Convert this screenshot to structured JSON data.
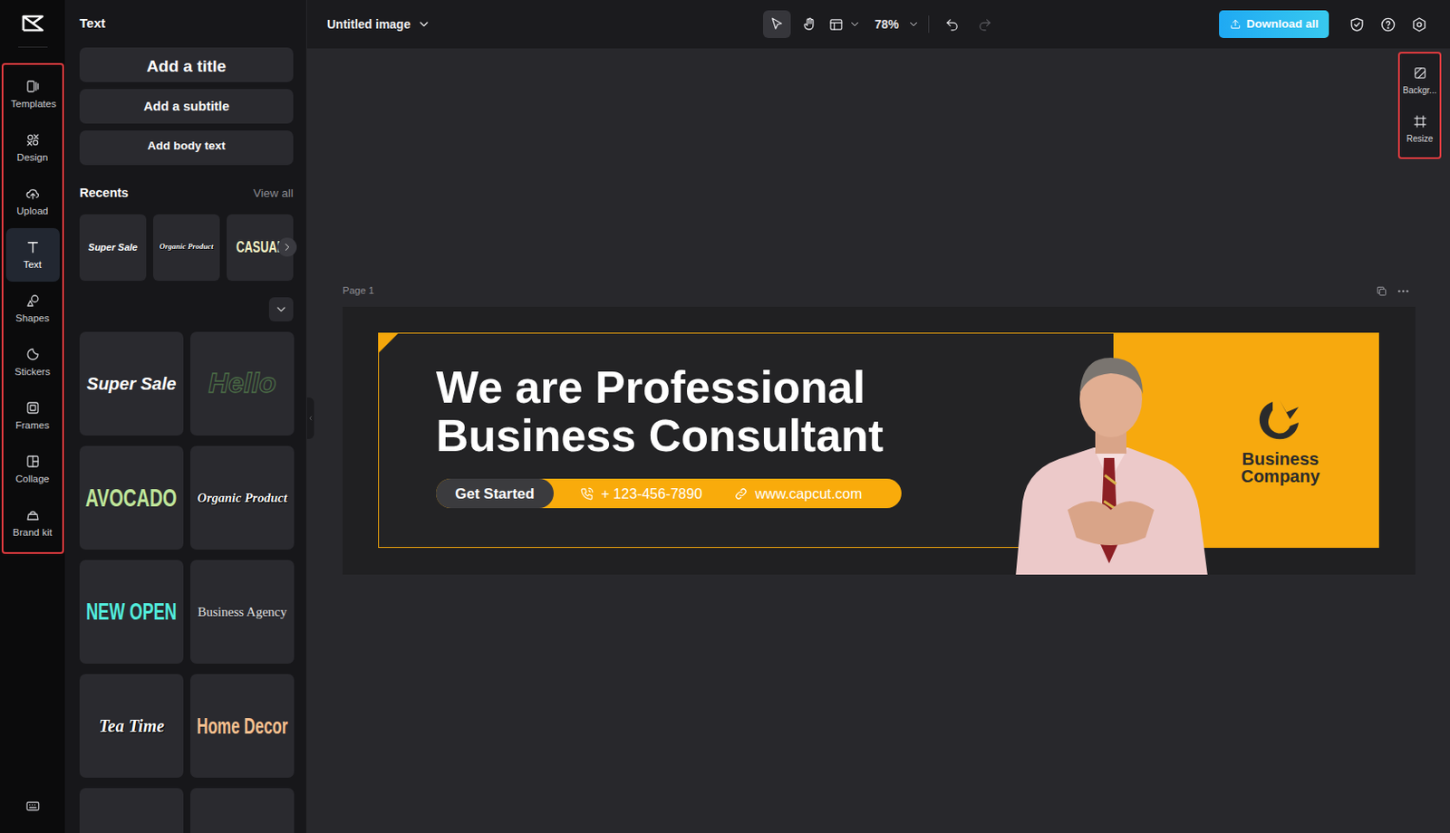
{
  "app": {
    "title": "Untitled image",
    "zoom": "78%",
    "download": "Download all",
    "select_tool_selected": true,
    "hand_tool_selected": false,
    "redo_disabled": true
  },
  "rail": {
    "items": [
      {
        "label": "Templates",
        "selected": false
      },
      {
        "label": "Design",
        "selected": false
      },
      {
        "label": "Upload",
        "selected": false
      },
      {
        "label": "Text",
        "selected": true
      },
      {
        "label": "Shapes",
        "selected": false
      },
      {
        "label": "Stickers",
        "selected": false
      },
      {
        "label": "Frames",
        "selected": false
      },
      {
        "label": "Collage",
        "selected": false
      },
      {
        "label": "Brand kit",
        "selected": false
      }
    ]
  },
  "panel": {
    "title": "Text",
    "buttons": [
      "Add a title",
      "Add a subtitle",
      "Add body text"
    ],
    "recents_title": "Recents",
    "view_all": "View all",
    "recents": [
      {
        "text": "Super Sale",
        "kind": "italic",
        "color": "#ffffff"
      },
      {
        "text": "Organic Product",
        "kind": "script",
        "color": "#ffffff"
      },
      {
        "text": "CASUAL",
        "kind": "condensed",
        "color": "#f2f0c4"
      }
    ],
    "presets": [
      {
        "text": "Super Sale",
        "kind": "italic",
        "color": "#ffffff"
      },
      {
        "text": "Hello",
        "kind": "outline",
        "color": "#4a6b46"
      },
      {
        "text": "AVOCADO",
        "kind": "condensed",
        "color": "#bfe59a"
      },
      {
        "text": "Organic Product",
        "kind": "script",
        "color": "#ffffff"
      },
      {
        "text": "NEW OPEN",
        "kind": "condensed",
        "color": "#52ecdc"
      },
      {
        "text": "Business Agency",
        "kind": "serif",
        "color": "#e0e0e0"
      },
      {
        "text": "Tea Time",
        "kind": "script",
        "color": "#ffffff"
      },
      {
        "text": "Home Decor",
        "kind": "condensed",
        "color": "#f6c08f"
      }
    ]
  },
  "right_rail": {
    "items": [
      "Backgr...",
      "Resize"
    ]
  },
  "canvas": {
    "page_label": "Page 1",
    "banner": {
      "headline": [
        "We are Professional",
        "Business Consultant"
      ],
      "cta": "Get Started",
      "phone": "+ 123-456-7890",
      "website": "www.capcut.com",
      "company": [
        "Business",
        "Company"
      ]
    }
  }
}
